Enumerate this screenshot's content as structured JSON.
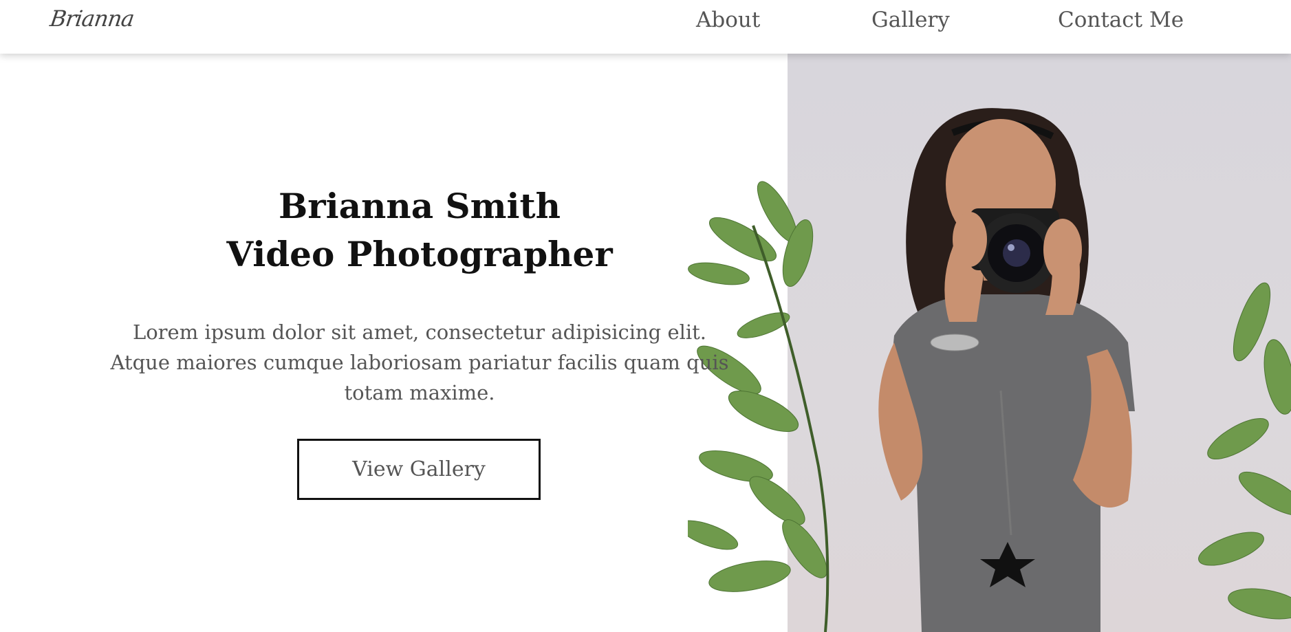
{
  "header": {
    "logo": "Brianna",
    "nav": {
      "about": "About",
      "gallery": "Gallery",
      "contact": "Contact Me"
    }
  },
  "hero": {
    "title_line1": "Brianna Smith",
    "title_line2": "Video Photographer",
    "description": "Lorem ipsum dolor sit amet, consectetur adipisicing elit. Atque maiores cumque laboriosam pariatur facilis quam quis totam maxime.",
    "cta_label": "View Gallery"
  },
  "colors": {
    "photo_background": "#dad7dc",
    "text_dark": "#111111",
    "text_muted": "#555555"
  }
}
